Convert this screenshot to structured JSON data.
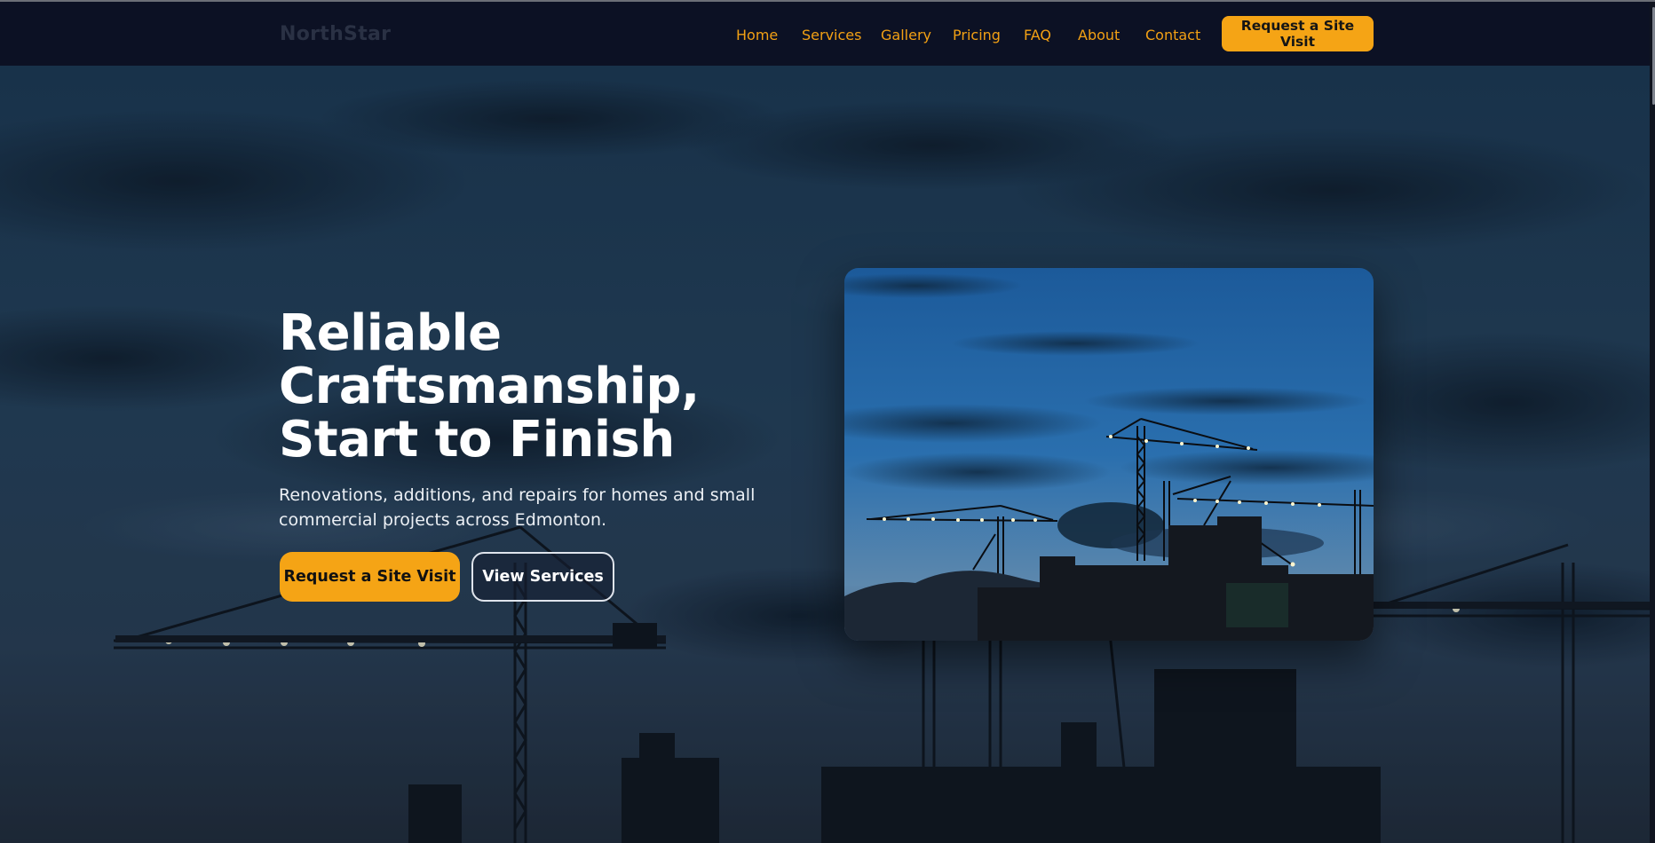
{
  "brand": {
    "name": "NorthStar"
  },
  "nav": {
    "links": [
      "Home",
      "Services",
      "Gallery",
      "Pricing",
      "FAQ",
      "About",
      "Contact"
    ],
    "cta_label": "Request a Site Visit"
  },
  "hero": {
    "title": "Reliable Craftsmanship, Start to Finish",
    "subtitle": "Renovations, additions, and repairs for homes and small commercial projects across Edmonton.",
    "primary_button": "Request a Site Visit",
    "secondary_button": "View Services"
  },
  "colors": {
    "accent": "#f5a415",
    "nav_bg": "#0c1124",
    "text": "#ffffff"
  }
}
